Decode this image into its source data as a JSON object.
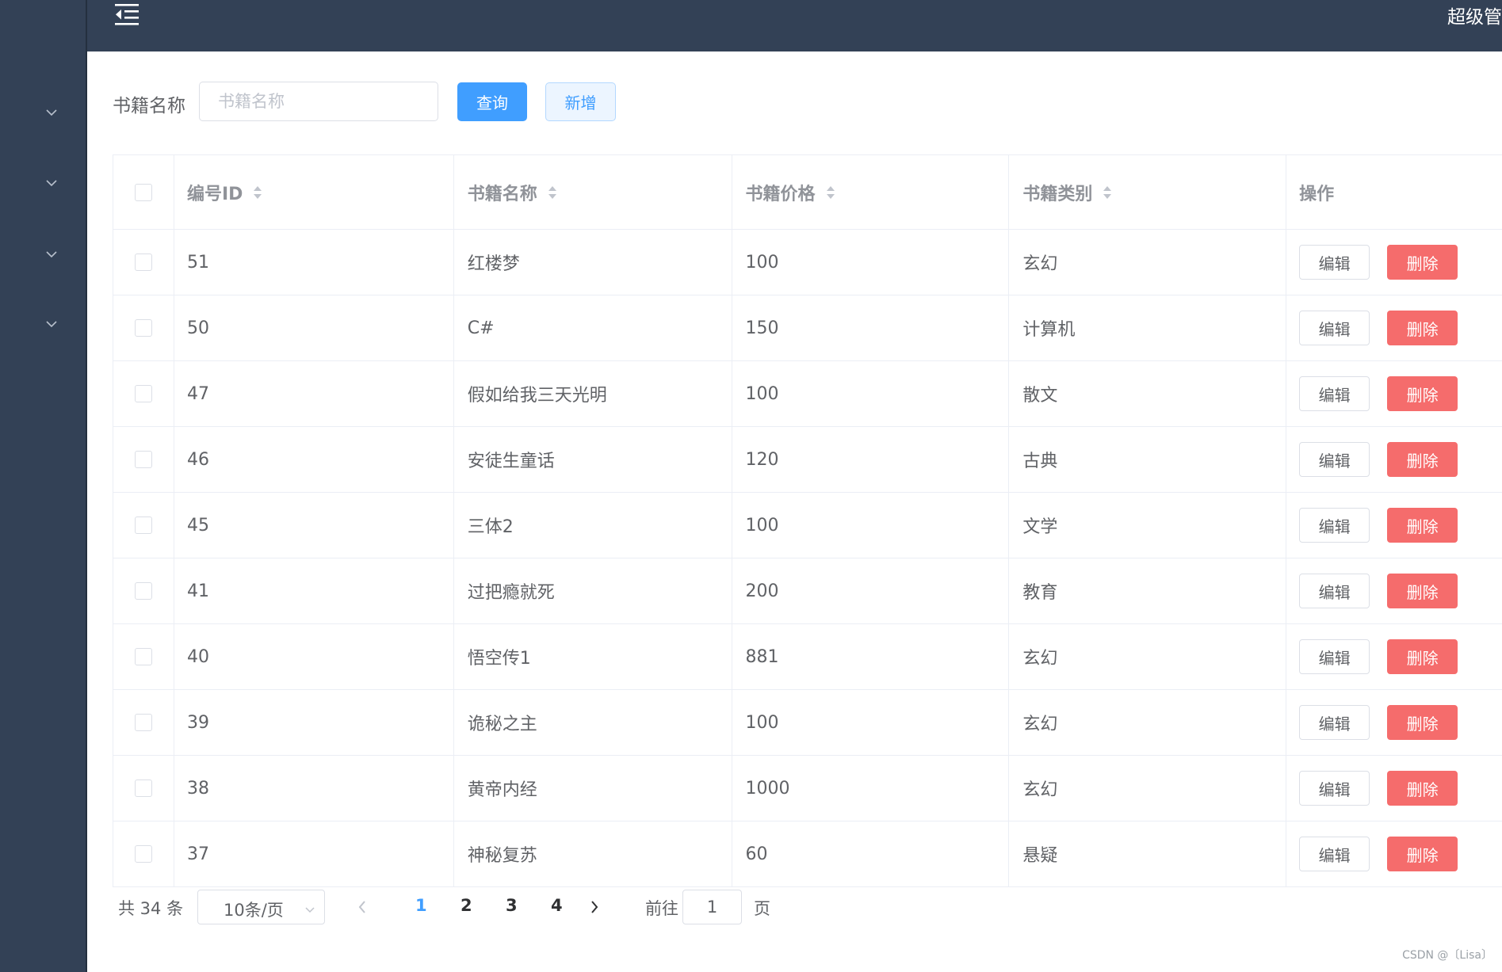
{
  "header": {
    "user_text": "超级管"
  },
  "sidebar": {
    "items": [
      {
        "icon": "chevron-down-icon"
      },
      {
        "icon": "chevron-down-icon"
      },
      {
        "icon": "chevron-down-icon"
      },
      {
        "icon": "chevron-down-icon"
      }
    ]
  },
  "search": {
    "label": "书籍名称",
    "placeholder": "书籍名称",
    "value": "",
    "query_label": "查询",
    "add_label": "新增"
  },
  "table": {
    "columns": [
      "编号ID",
      "书籍名称",
      "书籍价格",
      "书籍类别",
      "操作"
    ],
    "rows": [
      {
        "id": "51",
        "name": "红楼梦",
        "price": "100",
        "type": "玄幻"
      },
      {
        "id": "50",
        "name": "C#",
        "price": "150",
        "type": "计算机"
      },
      {
        "id": "47",
        "name": "假如给我三天光明",
        "price": "100",
        "type": "散文"
      },
      {
        "id": "46",
        "name": "安徒生童话",
        "price": "120",
        "type": "古典"
      },
      {
        "id": "45",
        "name": "三体2",
        "price": "100",
        "type": "文学"
      },
      {
        "id": "41",
        "name": "过把瘾就死",
        "price": "200",
        "type": "教育"
      },
      {
        "id": "40",
        "name": "悟空传1",
        "price": "881",
        "type": "玄幻"
      },
      {
        "id": "39",
        "name": "诡秘之主",
        "price": "100",
        "type": "玄幻"
      },
      {
        "id": "38",
        "name": "黄帝内经",
        "price": "1000",
        "type": "玄幻"
      },
      {
        "id": "37",
        "name": "神秘复苏",
        "price": "60",
        "type": "悬疑"
      }
    ],
    "edit_label": "编辑",
    "delete_label": "删除"
  },
  "pagination": {
    "total_text": "共 34 条",
    "page_size": "10条/页",
    "pages": [
      "1",
      "2",
      "3",
      "4"
    ],
    "current": "1",
    "goto_label": "前往",
    "jump_value": "1",
    "page_suffix": "页"
  },
  "watermark": "CSDN @〔Lisa〕",
  "colors": {
    "sidebar": "#334156",
    "primary": "#409eff",
    "danger": "#f56c6c"
  }
}
